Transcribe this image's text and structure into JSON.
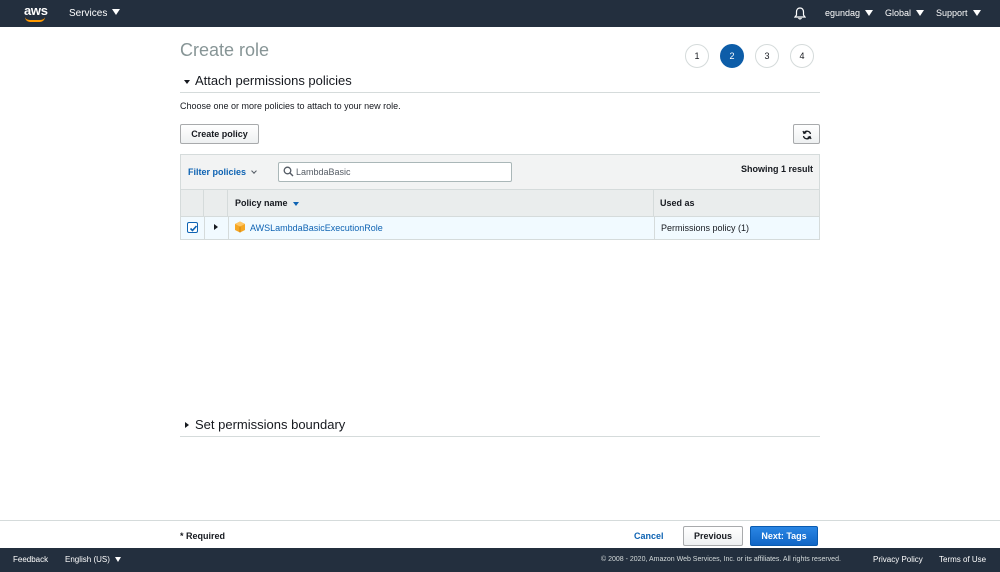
{
  "topnav": {
    "logo_text": "aws",
    "services_label": "Services",
    "user_label": "egundag",
    "region_label": "Global",
    "support_label": "Support"
  },
  "page": {
    "title": "Create role",
    "steps": [
      "1",
      "2",
      "3",
      "4"
    ],
    "active_step": "2"
  },
  "attach_section": {
    "header": "Attach permissions policies",
    "description": "Choose one or more policies to attach to your new role.",
    "create_policy_label": "Create policy",
    "filter_label": "Filter policies",
    "search_value": "LambdaBasic",
    "showing_text": "Showing 1 result",
    "columns": [
      "Policy name",
      "Used as"
    ],
    "rows": [
      {
        "checked": true,
        "policy_name": "AWSLambdaBasicExecutionRole",
        "used_as": "Permissions policy (1)"
      }
    ]
  },
  "boundary_section": {
    "header": "Set permissions boundary"
  },
  "action_bar": {
    "required_label": "* Required",
    "cancel_label": "Cancel",
    "previous_label": "Previous",
    "next_label": "Next: Tags"
  },
  "footer": {
    "feedback_label": "Feedback",
    "language_label": "English (US)",
    "copyright": "© 2008 - 2020, Amazon Web Services, Inc. or its affiliates. All rights reserved.",
    "privacy_label": "Privacy Policy",
    "terms_label": "Terms of Use"
  },
  "colors": {
    "nav_bg": "#232f3e",
    "accent": "#0e63b3",
    "step_active": "#0d5da8",
    "brand_orange": "#ff9900",
    "selected_row": "#f1faff"
  }
}
